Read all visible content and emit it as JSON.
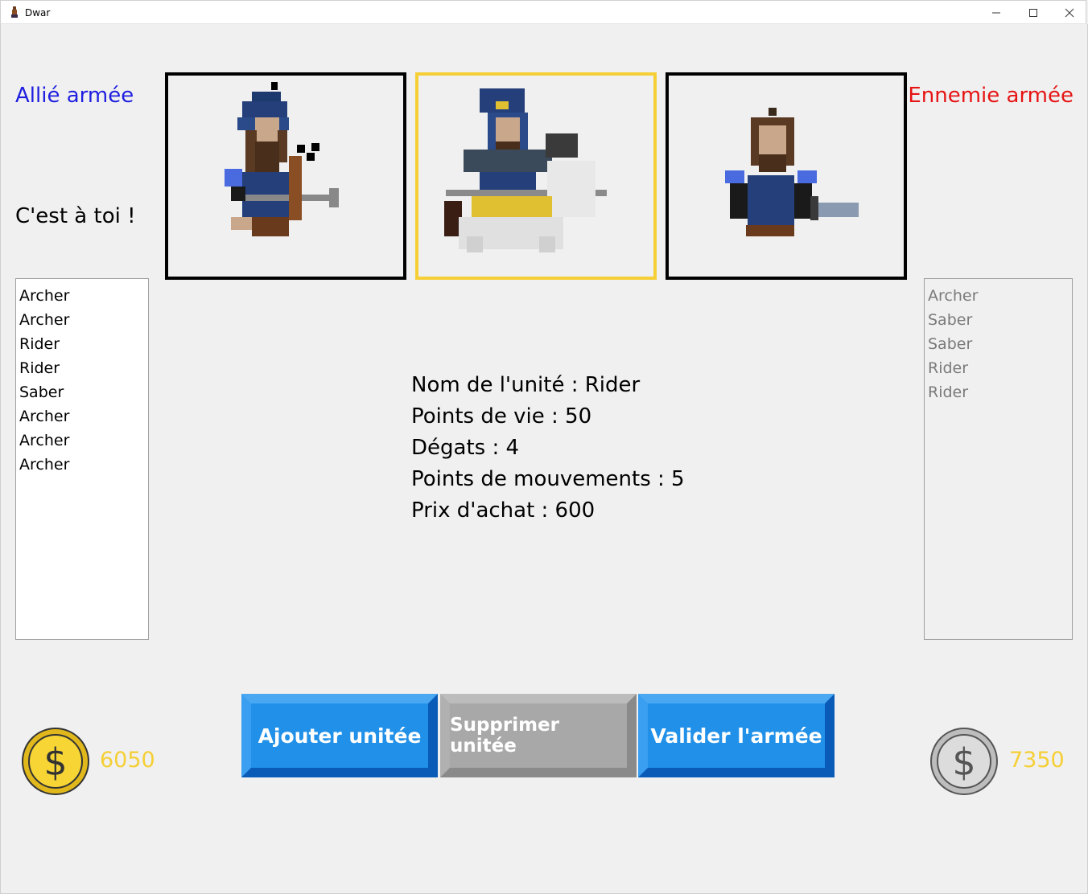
{
  "window": {
    "title": "Dwar"
  },
  "labels": {
    "ally": "Allié armée",
    "enemy": "Ennemie armée",
    "turn": "C'est à toi !"
  },
  "units": [
    {
      "name": "archer-sprite"
    },
    {
      "name": "rider-sprite",
      "selected": true
    },
    {
      "name": "saber-sprite"
    }
  ],
  "ally_list": [
    "Archer",
    "Archer",
    "Rider",
    "Rider",
    "Saber",
    "Archer",
    "Archer",
    "Archer"
  ],
  "enemy_list": [
    "Archer",
    "Saber",
    "Saber",
    "Rider",
    "Rider"
  ],
  "info": {
    "name": "Nom de l'unité : Rider",
    "hp": "Points de vie : 50",
    "damage": "Dégats : 4",
    "move": "Points de mouvements : 5",
    "price": "Prix d'achat : 600"
  },
  "buttons": {
    "add": "Ajouter unitée",
    "remove": "Supprimer unitée",
    "validate": "Valider l'armée"
  },
  "gold": {
    "ally": "6050",
    "enemy": "7350"
  },
  "colors": {
    "ally": "#1f1fe0",
    "enemy": "#e61414",
    "gold": "#f5cf35",
    "button": "#2090e8",
    "selected_border": "#f5cf35"
  }
}
